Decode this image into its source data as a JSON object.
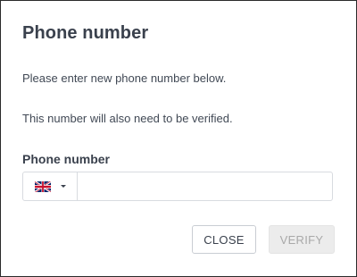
{
  "dialog": {
    "title": "Phone number",
    "description_1": "Please enter new phone number below.",
    "description_2": "This number will also need to be verified.",
    "field_label": "Phone number",
    "country": {
      "flag": "uk-flag-icon",
      "code": "GB"
    },
    "phone_value": "",
    "phone_placeholder": "",
    "buttons": {
      "close": "CLOSE",
      "verify": "VERIFY"
    },
    "verify_disabled": true
  }
}
